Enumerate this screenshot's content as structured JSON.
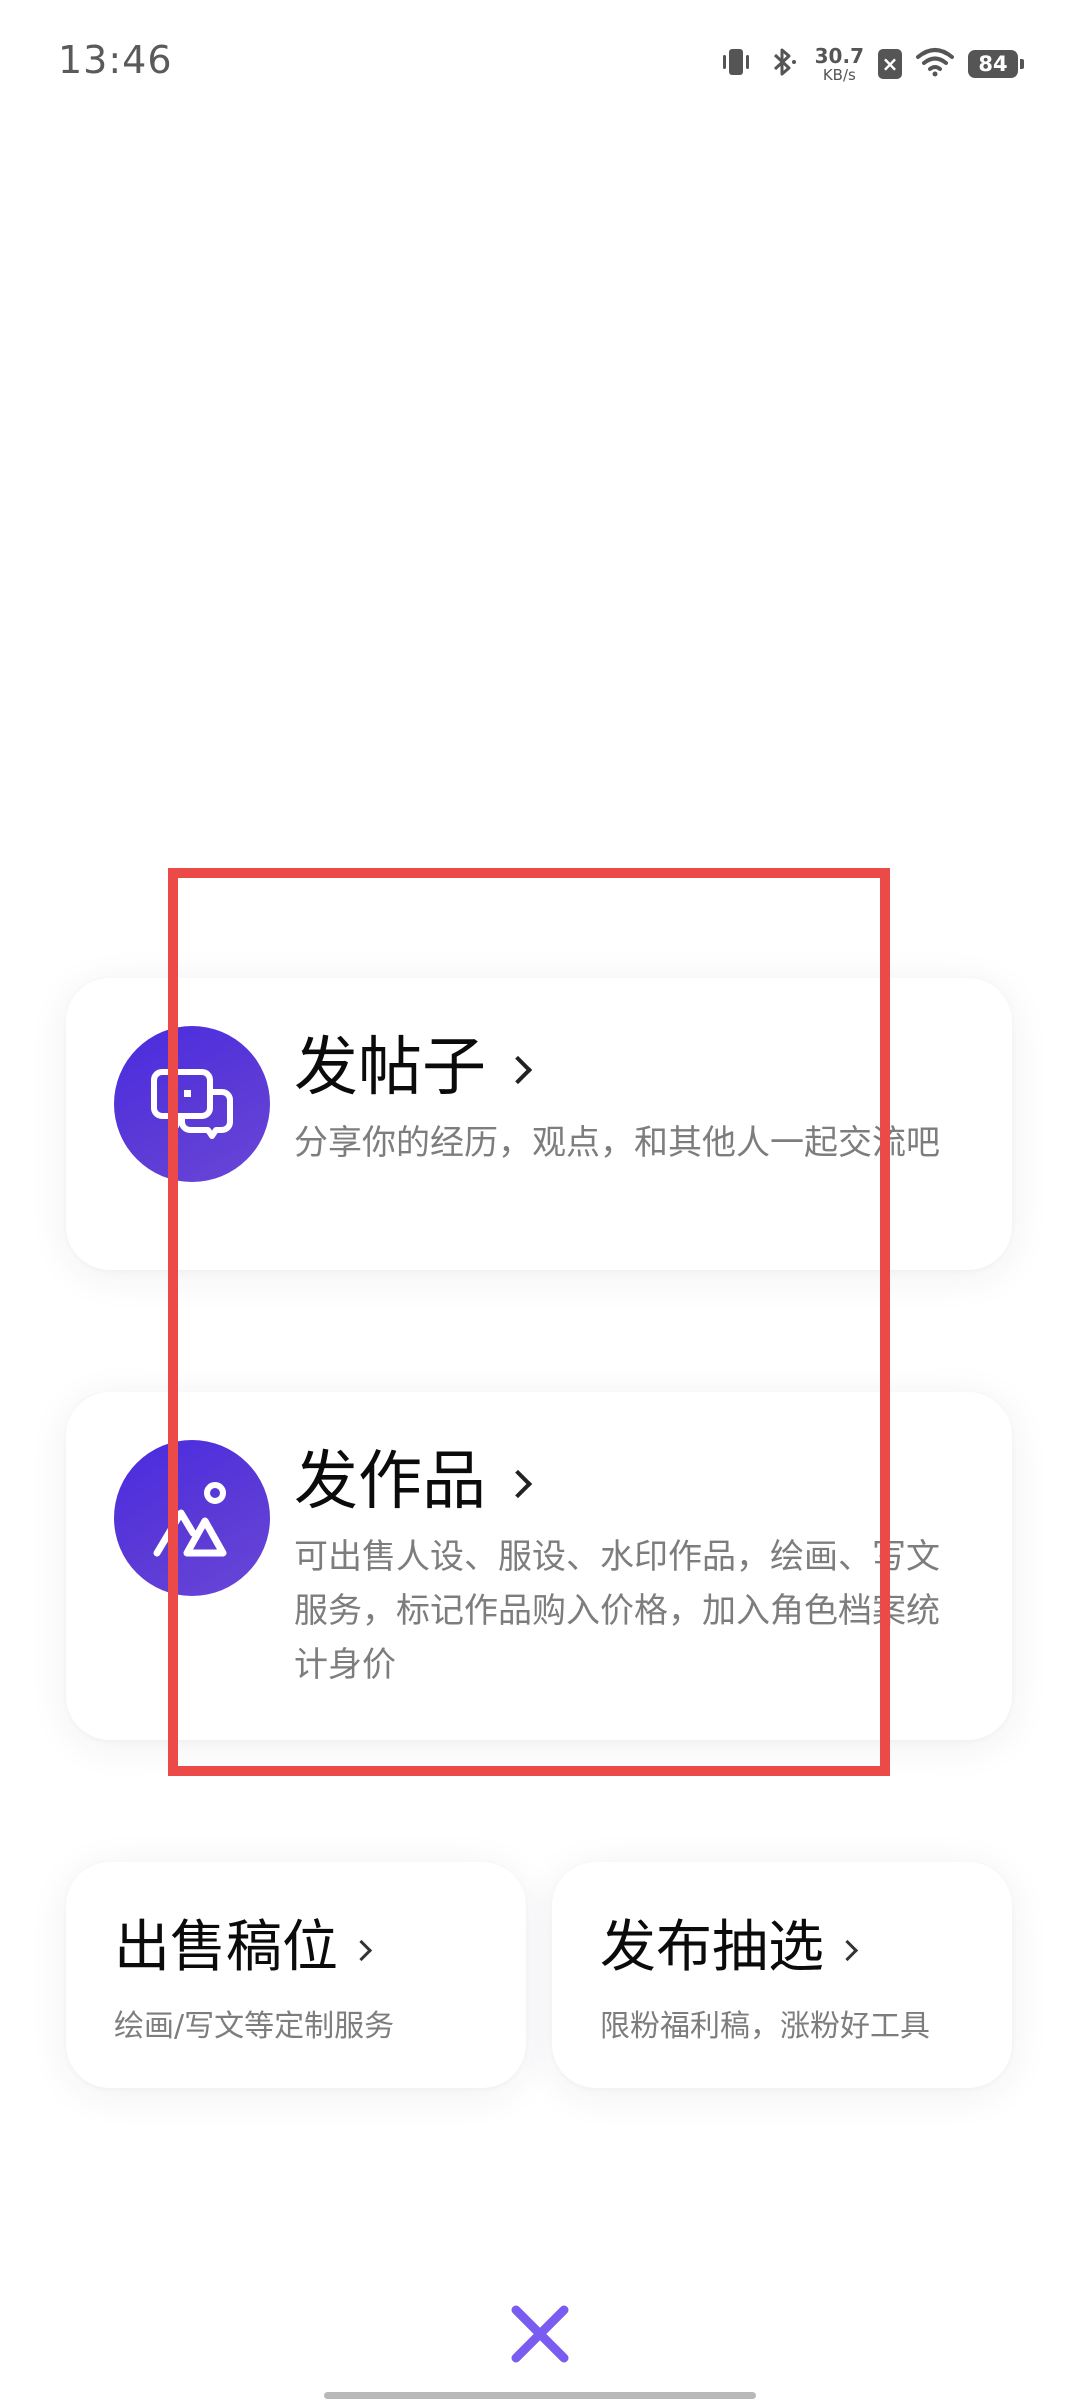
{
  "status_bar": {
    "time": "13:46",
    "net_speed_value": "30.7",
    "net_speed_unit": "KB/s",
    "battery": "84",
    "icons": [
      "vibrate-icon",
      "bluetooth-icon",
      "close-box-icon",
      "wifi-icon",
      "battery-icon"
    ]
  },
  "cards": {
    "post": {
      "title": "发帖子",
      "desc": "分享你的经历，观点，和其他人一起交流吧",
      "icon": "chat-bubble-icon"
    },
    "work": {
      "title": "发作品",
      "desc": "可出售人设、服设、水印作品，绘画、写文服务，标记作品购入价格，加入角色档案统计身价",
      "icon": "image-shapes-icon"
    },
    "sell_slot": {
      "title": "出售稿位",
      "desc": "绘画/写文等定制服务"
    },
    "draw": {
      "title": "发布抽选",
      "desc": "限粉福利稿，涨粉好工具"
    }
  },
  "colors": {
    "accent_purple": "#5b3ad6",
    "highlight_red": "#ec4a48",
    "close_purple": "#7b5cf0"
  },
  "close_icon": "close-icon"
}
